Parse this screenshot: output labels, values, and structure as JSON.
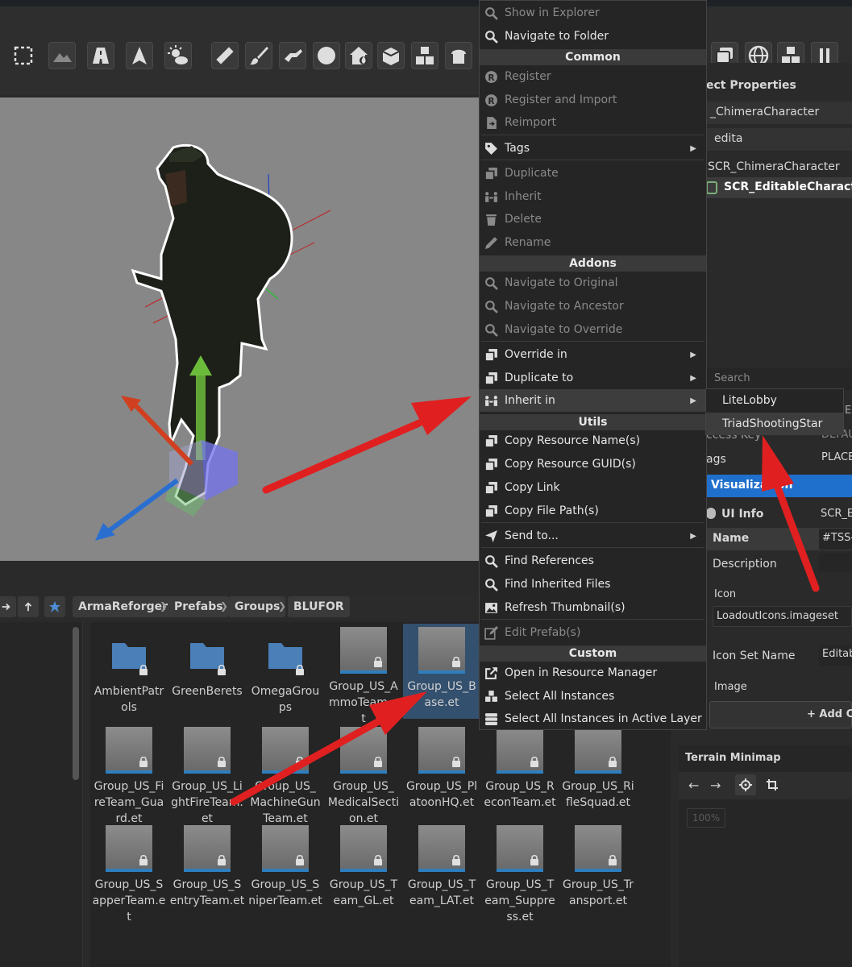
{
  "toolbar": {
    "tools_left": [
      "select-region-icon",
      "terrain-icon",
      "road-icon",
      "arrow-up-icon",
      "weather-icon",
      "measure-icon",
      "brush-icon",
      "hand-icon",
      "sphere-icon",
      "house-fire-icon",
      "box-icon",
      "boxes-icon",
      "bread-icon"
    ],
    "tools_right": [
      "layers-icon",
      "globe-icon",
      "boxes-icon",
      "pause-icon"
    ]
  },
  "breadcrumb": [
    "ArmaReforger",
    "Prefabs",
    "Groups",
    "BLUFOR"
  ],
  "files": [
    {
      "label": "AmbientPatrols",
      "kind": "folder"
    },
    {
      "label": "GreenBerets",
      "kind": "folder"
    },
    {
      "label": "OmegaGroups",
      "kind": "folder"
    },
    {
      "label": "Group_US_AmmoTeam.et",
      "kind": "prefab"
    },
    {
      "label": "Group_US_Base.et",
      "kind": "prefab",
      "selected": true
    },
    {
      "label": "Group_US_FireTeam_Guard.et",
      "kind": "prefab"
    },
    {
      "label": "Group_US_LightFireTeam.et",
      "kind": "prefab"
    },
    {
      "label": "Group_US_MachineGunTeam.et",
      "kind": "prefab"
    },
    {
      "label": "Group_US_MedicalSection.et",
      "kind": "prefab"
    },
    {
      "label": "Group_US_PlatoonHQ.et",
      "kind": "prefab"
    },
    {
      "label": "Group_US_ReconTeam.et",
      "kind": "prefab"
    },
    {
      "label": "Group_US_RifleSquad.et",
      "kind": "prefab"
    },
    {
      "label": "Group_US_SapperTeam.et",
      "kind": "prefab"
    },
    {
      "label": "Group_US_SentryTeam.et",
      "kind": "prefab"
    },
    {
      "label": "Group_US_SniperTeam.et",
      "kind": "prefab"
    },
    {
      "label": "Group_US_Team_GL.et",
      "kind": "prefab"
    },
    {
      "label": "Group_US_Team_LAT.et",
      "kind": "prefab"
    },
    {
      "label": "Group_US_Team_Suppress.et",
      "kind": "prefab"
    },
    {
      "label": "Group_US_Transport.et",
      "kind": "prefab"
    }
  ],
  "menu": {
    "show_in_explorer": "Show in Explorer",
    "navigate_to_folder": "Navigate to Folder",
    "sec_common": "Common",
    "register": "Register",
    "register_import": "Register and Import",
    "reimport": "Reimport",
    "tags": "Tags",
    "duplicate": "Duplicate",
    "inherit": "Inherit",
    "delete": "Delete",
    "rename": "Rename",
    "sec_addons": "Addons",
    "nav_original": "Navigate to Original",
    "nav_ancestor": "Navigate to Ancestor",
    "nav_override": "Navigate to Override",
    "override_in": "Override in",
    "duplicate_to": "Duplicate to",
    "inherit_in": "Inherit in",
    "sec_utils": "Utils",
    "copy_names": "Copy Resource Name(s)",
    "copy_guids": "Copy Resource GUID(s)",
    "copy_link": "Copy Link",
    "copy_paths": "Copy File Path(s)",
    "send_to": "Send to...",
    "find_refs": "Find References",
    "find_inherited": "Find Inherited Files",
    "refresh_thumb": "Refresh Thumbnail(s)",
    "edit_prefab": "Edit Prefab(s)",
    "sec_custom": "Custom",
    "open_rm": "Open in Resource Manager",
    "select_all": "Select All Instances",
    "select_all_layer": "Select All Instances in Active Layer"
  },
  "submenu": {
    "item1": "LiteLobby",
    "item2": "TriadShootingStar"
  },
  "props": {
    "title": "ect Properties",
    "class_field": "_ChimeraCharacter",
    "filter_field": "edita",
    "tree1": "SCR_ChimeraCharacter",
    "tree2": "SCR_EditableCharacter",
    "search_placeholder": "Search",
    "access_key": "ccess Key",
    "access_val": "DEFAU",
    "tags": "ags",
    "tags_val": "PLACE",
    "visualization": "Visualization",
    "ui_info": "UI Info",
    "ui_info_val": "SCR_E",
    "name": "Name",
    "name_val": "#TSS-",
    "description": "Description",
    "icon": "Icon",
    "icon_val": "LoadoutIcons.imageset",
    "icon_set_name": "Icon Set Name",
    "icon_set_val": "Editab",
    "image": "Image",
    "add_button": "+ Add Co",
    "sub_tag": "EN"
  },
  "terrain": {
    "title": "Terrain Minimap",
    "zoom": "100%"
  },
  "colors": {
    "accent": "#1f6fcc",
    "arrow": "#e02020",
    "menu_bg": "#252525"
  }
}
